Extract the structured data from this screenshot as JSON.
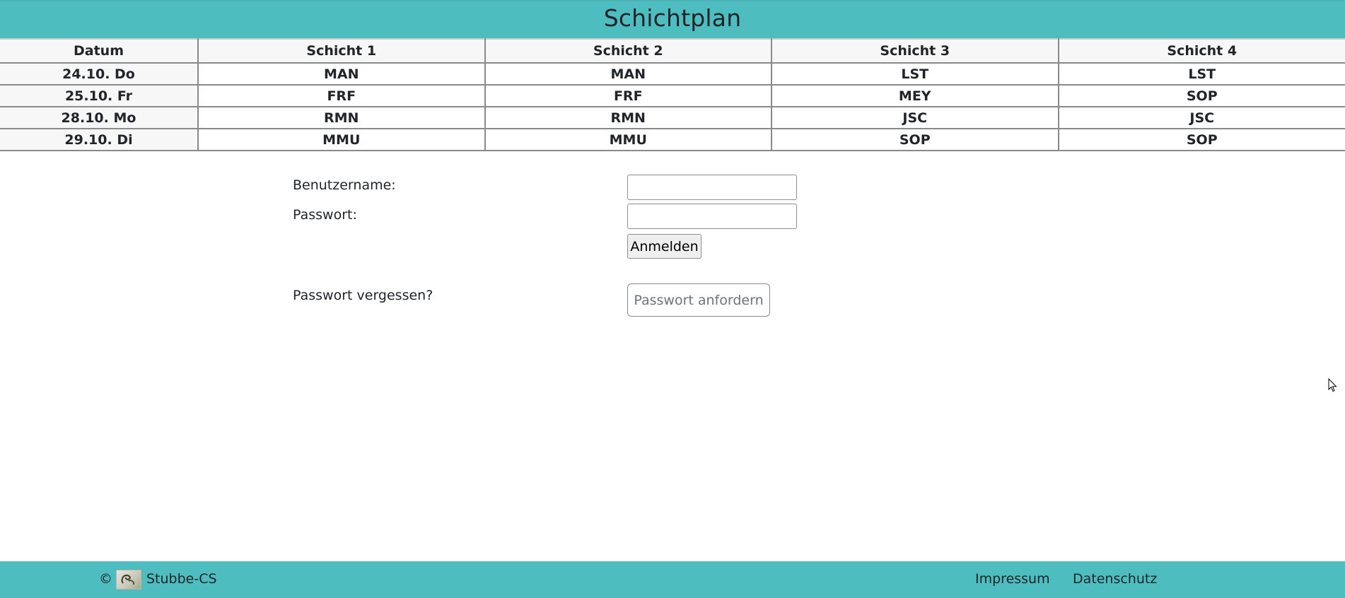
{
  "header": {
    "title": "Schichtplan"
  },
  "table": {
    "columns": [
      "Datum",
      "Schicht 1",
      "Schicht 2",
      "Schicht 3",
      "Schicht 4"
    ],
    "rows": [
      [
        "24.10. Do",
        "MAN",
        "MAN",
        "LST",
        "LST"
      ],
      [
        "25.10. Fr",
        "FRF",
        "FRF",
        "MEY",
        "SOP"
      ],
      [
        "28.10. Mo",
        "RMN",
        "RMN",
        "JSC",
        "JSC"
      ],
      [
        "29.10. Di",
        "MMU",
        "MMU",
        "SOP",
        "SOP"
      ]
    ]
  },
  "login": {
    "username_label": "Benutzername:",
    "username_value": "",
    "password_label": "Passwort:",
    "password_value": "",
    "submit_label": "Anmelden",
    "forgot_label": "Passwort vergessen?",
    "request_label": "Passwort anfordern"
  },
  "footer": {
    "copyright_symbol": "©",
    "logo_icon": "company-logo-icon",
    "brand": "Stubbe-CS",
    "impressum": "Impressum",
    "datenschutz": "Datenschutz"
  },
  "colors": {
    "accent": "#4ebdbf",
    "table_border": "#8a8a8a",
    "header_cell_bg": "#f7f7f7"
  }
}
